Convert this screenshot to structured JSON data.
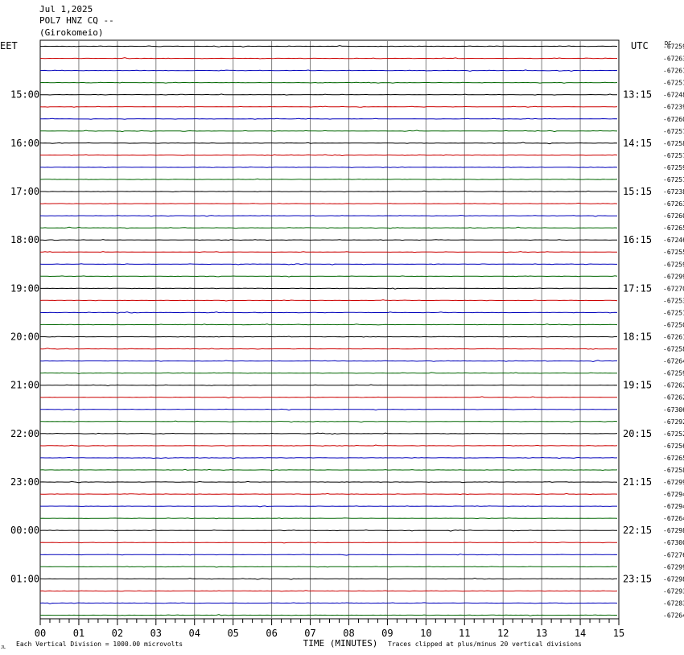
{
  "header": {
    "date": "Jul 1,2025",
    "station": "POL7 HNZ CQ --",
    "location": "(Girokomeio)"
  },
  "labels": {
    "left_tz": "EET",
    "right_tz": "UTC",
    "right_top": "DC",
    "xlabel": "TIME (MINUTES)",
    "scale_note": "Each Vertical Division = 1000.00 microvolts",
    "clip_note": "Traces clipped at plus/minus 20 vertical divisions",
    "corner_mark": "JL"
  },
  "colors": {
    "cycle": [
      "#000000",
      "#cc0000",
      "#0000bb",
      "#006600"
    ],
    "grid": "#808080"
  },
  "chart_data": {
    "type": "line",
    "x_ticks": [
      "00",
      "01",
      "02",
      "03",
      "04",
      "05",
      "06",
      "07",
      "08",
      "09",
      "10",
      "11",
      "12",
      "13",
      "14",
      "15"
    ],
    "xlim": [
      0,
      15
    ],
    "left_hour_labels": [
      "15:00",
      "16:00",
      "17:00",
      "18:00",
      "19:00",
      "20:00",
      "21:00",
      "22:00",
      "23:00",
      "00:00",
      "01:00"
    ],
    "right_hour_labels": [
      "13:15",
      "14:15",
      "15:15",
      "16:15",
      "17:15",
      "18:15",
      "19:15",
      "20:15",
      "21:15",
      "22:15",
      "23:15"
    ],
    "trace_offsets": [
      -67259,
      -67263,
      -67261,
      -67251,
      -67248,
      -67239,
      -67260,
      -67257,
      -67258,
      -67257,
      -67259,
      -67251,
      -67238,
      -67263,
      -67260,
      -67265,
      -67246,
      -67255,
      -67259,
      -67299,
      -67270,
      -67253,
      -67251,
      -67250,
      -67261,
      -67258,
      -67264,
      -67259,
      -67262,
      -67262,
      -67306,
      -67292,
      -67252,
      -67256,
      -67265,
      -67258,
      -67299,
      -67294,
      -67294,
      -67264,
      -67298,
      -67300,
      -67276,
      -67299,
      -67298,
      -67293,
      -67283,
      -67264
    ]
  }
}
